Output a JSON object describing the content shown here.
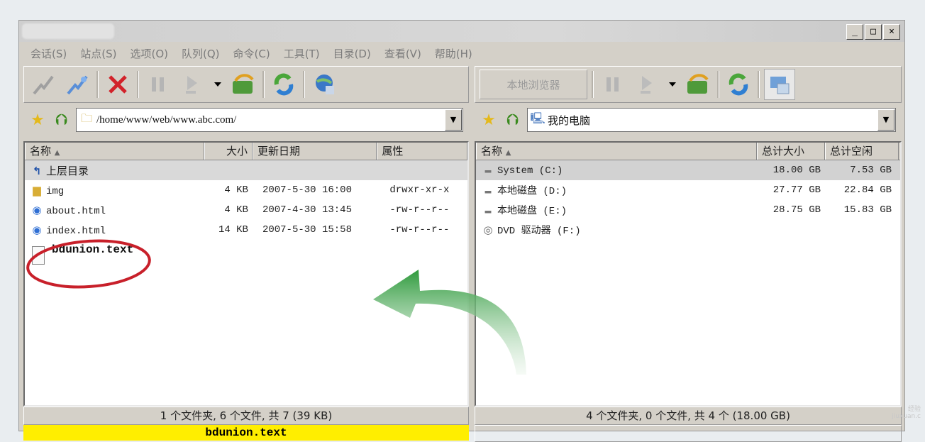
{
  "window": {
    "controls": [
      "_",
      "□",
      "×"
    ]
  },
  "menu": [
    "会话(S)",
    "站点(S)",
    "选项(O)",
    "队列(Q)",
    "命令(C)",
    "工具(T)",
    "目录(D)",
    "查看(V)",
    "帮助(H)"
  ],
  "left_pane": {
    "toolbar_icons": [
      "connect-icon",
      "quick-connect-icon",
      "disconnect-icon",
      "pause-icon",
      "transfer-icon",
      "dropdown-icon",
      "refresh-icon",
      "sync-icon",
      "site-manager-icon"
    ],
    "path": "/home/www/web/www.abc.com/",
    "columns": [
      "名称",
      "大小",
      "更新日期",
      "属性"
    ],
    "rows": [
      {
        "icon": "parent-dir",
        "name": "上层目录",
        "size": "",
        "date": "",
        "attr": ""
      },
      {
        "icon": "folder",
        "name": "img",
        "size": "4 KB",
        "date": "2007-5-30 16:00",
        "attr": "drwxr-xr-x"
      },
      {
        "icon": "html",
        "name": "about.html",
        "size": "4 KB",
        "date": "2007-4-30 13:45",
        "attr": "-rw-r--r--"
      },
      {
        "icon": "html",
        "name": "index.html",
        "size": "14 KB",
        "date": "2007-5-30 15:58",
        "attr": "-rw-r--r--"
      }
    ],
    "uploaded_file": "bdunion.text",
    "status": "1 个文件夹, 6 个文件, 共 7 (39 KB)",
    "selected": "bdunion.text"
  },
  "right_pane": {
    "local_browser_label": "本地浏览器",
    "path": "我的电脑",
    "columns": [
      "名称",
      "总计大小",
      "总计空闲"
    ],
    "rows": [
      {
        "icon": "drive",
        "name": "System (C:)",
        "total": "18.00 GB",
        "free": "7.53 GB"
      },
      {
        "icon": "drive",
        "name": "本地磁盘 (D:)",
        "total": "27.77 GB",
        "free": "22.84 GB"
      },
      {
        "icon": "drive",
        "name": "本地磁盘 (E:)",
        "total": "28.75 GB",
        "free": "15.83 GB"
      },
      {
        "icon": "dvd",
        "name": "DVD 驱动器 (F:)",
        "total": "",
        "free": ""
      }
    ],
    "status": "4 个文件夹, 0 个文件, 共 4 个 (18.00 GB)"
  },
  "colors": {
    "selection_bar": "#ffee00",
    "annotation_circle": "#c8202a",
    "arrow": "#2e9a3c"
  },
  "watermark": [
    "经验",
    "jiuxuan.c"
  ]
}
